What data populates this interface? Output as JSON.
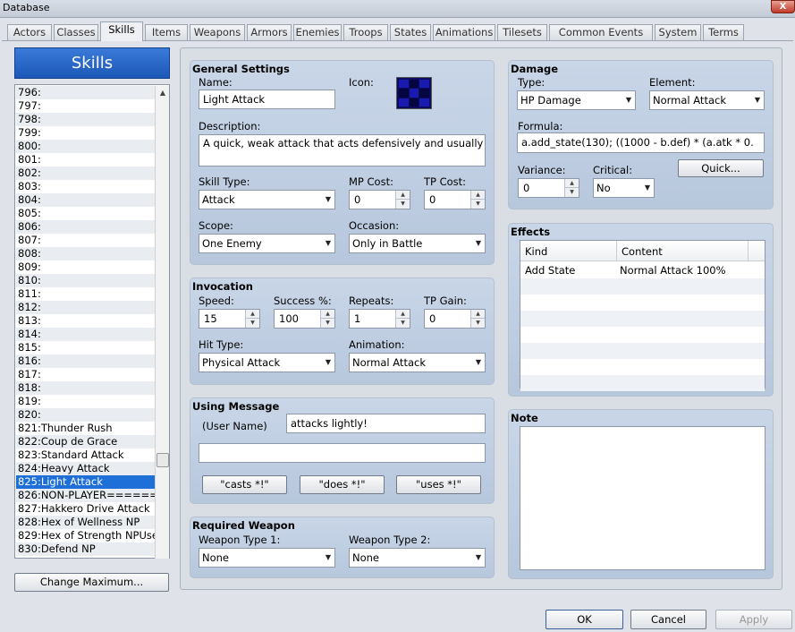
{
  "window": {
    "title": "Database",
    "close": "X"
  },
  "tabs": [
    "Actors",
    "Classes",
    "Skills",
    "Items",
    "Weapons",
    "Armors",
    "Enemies",
    "Troops",
    "States",
    "Animations",
    "Tilesets",
    "Common Events",
    "System",
    "Terms"
  ],
  "list": {
    "header": "Skills",
    "items": [
      "796:",
      "797:",
      "798:",
      "799:",
      "800:",
      "801:",
      "802:",
      "803:",
      "804:",
      "805:",
      "806:",
      "807:",
      "808:",
      "809:",
      "810:",
      "811:",
      "812:",
      "813:",
      "814:",
      "815:",
      "816:",
      "817:",
      "818:",
      "819:",
      "820:",
      "821:Thunder Rush",
      "822:Coup de Grace",
      "823:Standard Attack",
      "824:Heavy Attack",
      "825:Light Attack",
      "826:NON-PLAYER=======",
      "827:Hakkero Drive Attack",
      "828:Hex of Wellness NP",
      "829:Hex of Strength NPUse",
      "830:Defend NP"
    ],
    "selected_index": 29,
    "change_max": "Change Maximum..."
  },
  "general": {
    "title": "General Settings",
    "name_label": "Name:",
    "name": "Light Attack",
    "icon_label": "Icon:",
    "desc_label": "Description:",
    "description": "A quick, weak attack that acts defensively and usually",
    "skill_type_label": "Skill Type:",
    "skill_type": "Attack",
    "mp_label": "MP Cost:",
    "mp": "0",
    "tp_label": "TP Cost:",
    "tp": "0",
    "scope_label": "Scope:",
    "scope": "One Enemy",
    "occasion_label": "Occasion:",
    "occasion": "Only in Battle"
  },
  "invocation": {
    "title": "Invocation",
    "speed_label": "Speed:",
    "speed": "15",
    "success_label": "Success %:",
    "success": "100",
    "repeats_label": "Repeats:",
    "repeats": "1",
    "tpgain_label": "TP Gain:",
    "tpgain": "0",
    "hit_label": "Hit Type:",
    "hit": "Physical Attack",
    "anim_label": "Animation:",
    "anim": "Normal Attack"
  },
  "message": {
    "title": "Using Message",
    "user_label": "(User Name)",
    "line1": "attacks lightly!",
    "line2": "",
    "b1": "\"casts *!\"",
    "b2": "\"does *!\"",
    "b3": "\"uses *!\""
  },
  "weapon": {
    "title": "Required Weapon",
    "w1_label": "Weapon Type 1:",
    "w1": "None",
    "w2_label": "Weapon Type 2:",
    "w2": "None"
  },
  "damage": {
    "title": "Damage",
    "type_label": "Type:",
    "type": "HP Damage",
    "element_label": "Element:",
    "element": "Normal Attack",
    "formula_label": "Formula:",
    "formula": "a.add_state(130); ((1000 - b.def) * (a.atk * 0.",
    "variance_label": "Variance:",
    "variance": "0",
    "critical_label": "Critical:",
    "critical": "No",
    "quick": "Quick..."
  },
  "effects": {
    "title": "Effects",
    "col_kind": "Kind",
    "col_content": "Content",
    "rows": [
      {
        "kind": "Add State",
        "content": "Normal Attack 100%"
      }
    ]
  },
  "note": {
    "title": "Note"
  },
  "buttons": {
    "ok": "OK",
    "cancel": "Cancel",
    "apply": "Apply"
  }
}
